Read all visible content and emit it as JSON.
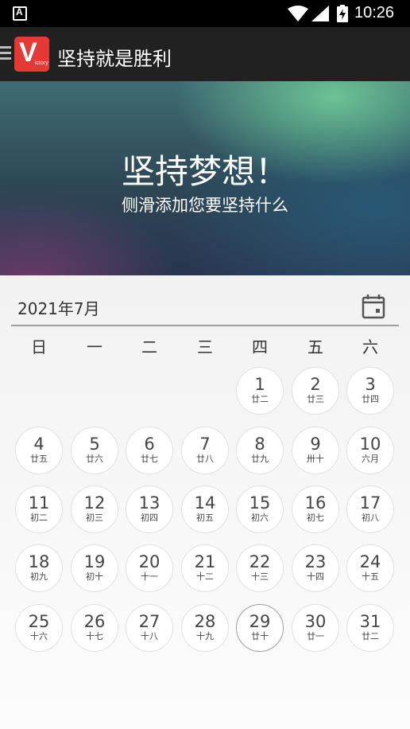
{
  "status_bar": {
    "time": "10:26"
  },
  "app": {
    "title": "坚持就是胜利",
    "logo_letter": "V",
    "logo_sub": "ictory"
  },
  "banner": {
    "title": "坚持梦想！",
    "subtitle": "侧滑添加您要坚持什么"
  },
  "calendar": {
    "month_label": "2021年7月",
    "weekdays": [
      "日",
      "一",
      "二",
      "三",
      "四",
      "五",
      "六"
    ],
    "today": "29",
    "days": [
      {
        "n": "1",
        "l": "廿二"
      },
      {
        "n": "2",
        "l": "廿三"
      },
      {
        "n": "3",
        "l": "廿四"
      },
      {
        "n": "4",
        "l": "廿五"
      },
      {
        "n": "5",
        "l": "廿六"
      },
      {
        "n": "6",
        "l": "廿七"
      },
      {
        "n": "7",
        "l": "廿八"
      },
      {
        "n": "8",
        "l": "廿九"
      },
      {
        "n": "9",
        "l": "卅十"
      },
      {
        "n": "10",
        "l": "六月"
      },
      {
        "n": "11",
        "l": "初二"
      },
      {
        "n": "12",
        "l": "初三"
      },
      {
        "n": "13",
        "l": "初四"
      },
      {
        "n": "14",
        "l": "初五"
      },
      {
        "n": "15",
        "l": "初六"
      },
      {
        "n": "16",
        "l": "初七"
      },
      {
        "n": "17",
        "l": "初八"
      },
      {
        "n": "18",
        "l": "初九"
      },
      {
        "n": "19",
        "l": "初十"
      },
      {
        "n": "20",
        "l": "十一"
      },
      {
        "n": "21",
        "l": "十二"
      },
      {
        "n": "22",
        "l": "十三"
      },
      {
        "n": "23",
        "l": "十四"
      },
      {
        "n": "24",
        "l": "十五"
      },
      {
        "n": "25",
        "l": "十六"
      },
      {
        "n": "26",
        "l": "十七"
      },
      {
        "n": "27",
        "l": "十八"
      },
      {
        "n": "28",
        "l": "十九"
      },
      {
        "n": "29",
        "l": "廿十"
      },
      {
        "n": "30",
        "l": "廿一"
      },
      {
        "n": "31",
        "l": "廿二"
      }
    ]
  }
}
